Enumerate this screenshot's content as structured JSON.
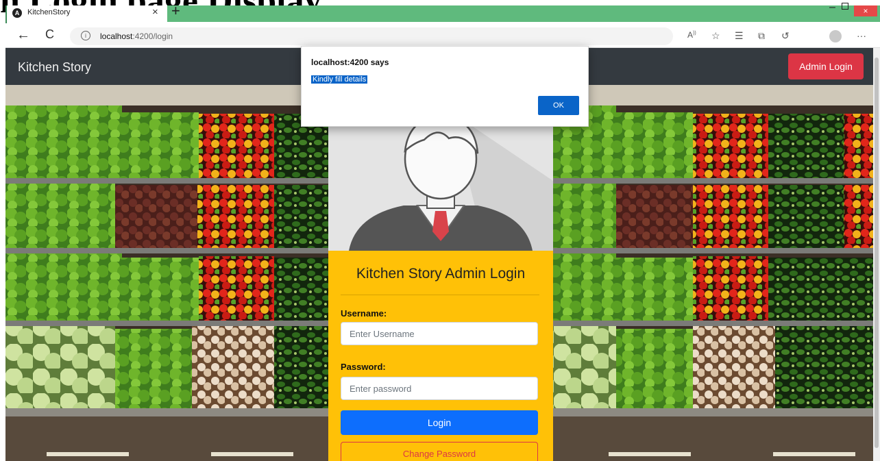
{
  "cropped_heading": "n Login page Display",
  "browser": {
    "tab_title": "KitchenStory",
    "tab_close": "×",
    "new_tab": "+",
    "window_minimize": "–",
    "window_close": "×",
    "back_glyph": "←",
    "refresh_glyph": "C",
    "url_host": "localhost",
    "url_rest": ":4200/login",
    "toolbar_icons": [
      "read-aloud-icon",
      "favorite-star-icon",
      "favorites-list-icon",
      "collections-icon",
      "history-icon",
      "profile-icon",
      "more-icon"
    ]
  },
  "navbar": {
    "brand": "Kitchen Story",
    "admin_login_label": "Admin Login"
  },
  "login_card": {
    "title": "Kitchen Story Admin Login",
    "username_label": "Username:",
    "username_placeholder": "Enter Username",
    "password_label": "Password:",
    "password_placeholder": "Enter password",
    "login_label": "Login",
    "change_password_label": "Change Password"
  },
  "alert_dialog": {
    "title": "localhost:4200 says",
    "message": "Kindly fill details",
    "ok_label": "OK"
  },
  "colors": {
    "tabbar": "#5fba7d",
    "navbar": "#343a40",
    "admin_button": "#dc3545",
    "card_body": "#ffc107",
    "login_button": "#0d6efd",
    "dialog_button": "#0a64c8"
  }
}
